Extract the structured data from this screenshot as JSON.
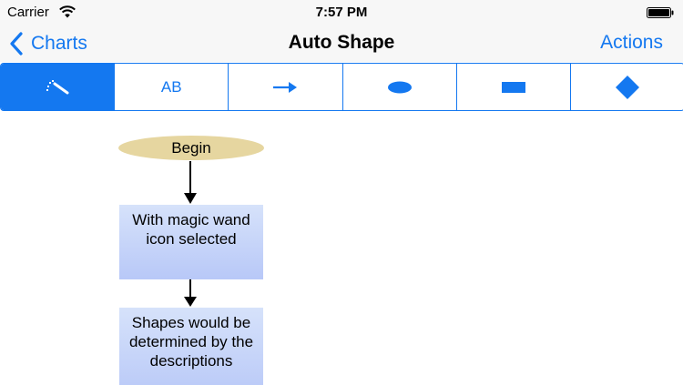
{
  "status_bar": {
    "carrier": "Carrier",
    "time": "7:57 PM"
  },
  "nav": {
    "back_label": "Charts",
    "title": "Auto Shape",
    "actions_label": "Actions"
  },
  "toolbar": {
    "segments": [
      {
        "icon": "magic-wand-icon",
        "selected": true
      },
      {
        "label": "AB",
        "icon": "text-icon",
        "selected": false
      },
      {
        "icon": "arrow-right-icon",
        "selected": false
      },
      {
        "icon": "ellipse-icon",
        "selected": false
      },
      {
        "icon": "rectangle-icon",
        "selected": false
      },
      {
        "icon": "diamond-icon",
        "selected": false
      }
    ]
  },
  "flowchart": {
    "begin": "Begin",
    "step1": "With magic wand icon selected",
    "step2": "Shapes would be determined by the descriptions"
  },
  "colors": {
    "accent": "#1478f0",
    "begin_fill": "#e6d6a0",
    "box_fill": "#c6d4f8"
  }
}
